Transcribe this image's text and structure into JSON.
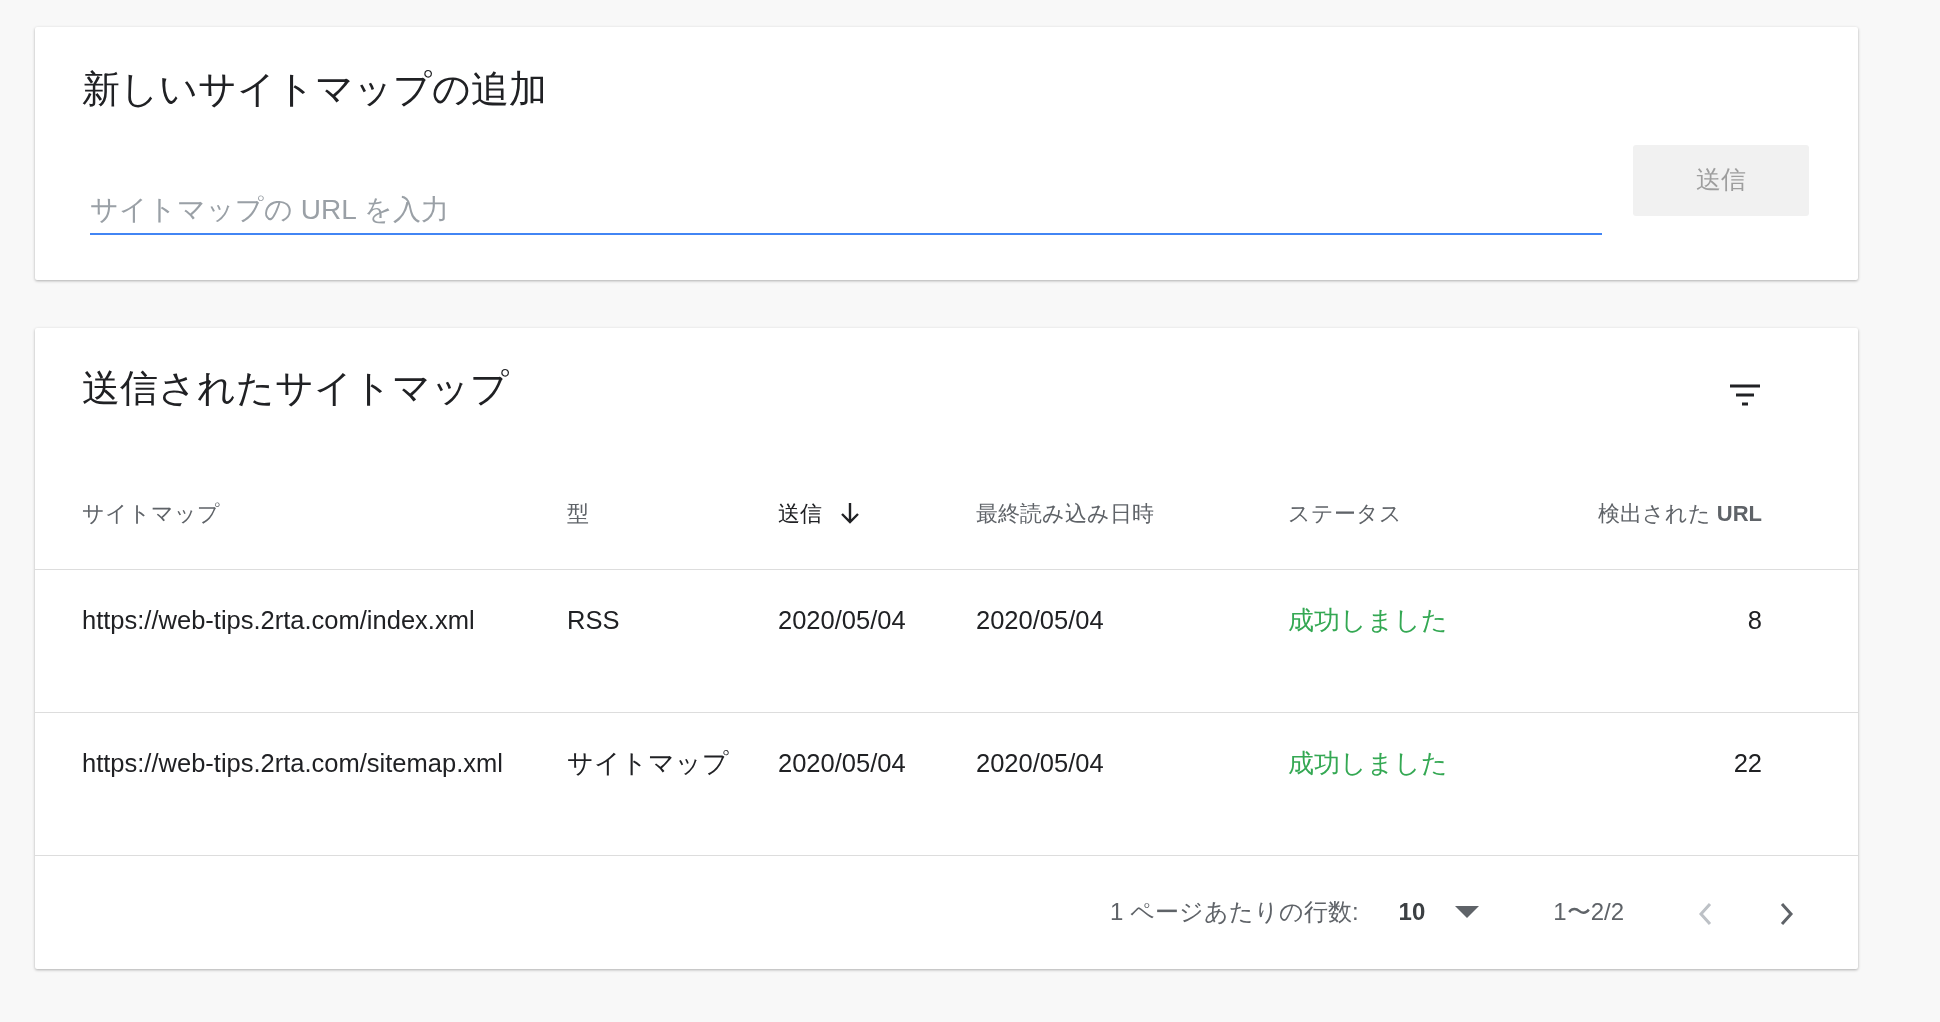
{
  "add_card": {
    "title": "新しいサイトマップの追加",
    "input": {
      "placeholder": "サイトマップの URL を入力"
    },
    "submit_button": {
      "label": "送信",
      "disabled": true
    }
  },
  "submitted_card": {
    "title": "送信されたサイトマップ",
    "table": {
      "columns": [
        {
          "label": "サイトマップ",
          "sorted": false
        },
        {
          "label": "型",
          "sorted": false
        },
        {
          "label": "送信",
          "sorted": true
        },
        {
          "label": "最終読み込み日時",
          "sorted": false
        },
        {
          "label": "ステータス",
          "sorted": false
        },
        {
          "label": "検出された **URL**",
          "sorted": false
        }
      ],
      "rows": [
        [
          "https://web-tips.2rta.com/index.xml",
          "RSS",
          "2020/05/04",
          "2020/05/04",
          "成功しました",
          "8"
        ],
        [
          "https://web-tips.2rta.com/sitemap.xml",
          "サイトマップ",
          "2020/05/04",
          "2020/05/04",
          "成功しました",
          "22"
        ]
      ]
    },
    "pagination": {
      "rows_per_page_label": "1 ページあたりの行数:",
      "rows_per_page": "10",
      "range": "1〜2/2",
      "prev_disabled": true,
      "next_disabled": false
    }
  }
}
